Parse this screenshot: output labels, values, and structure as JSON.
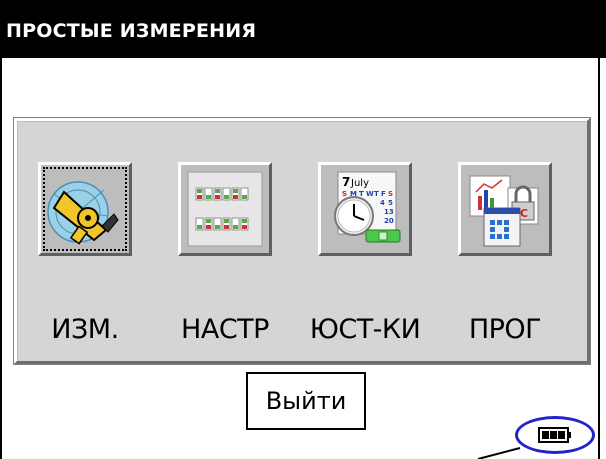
{
  "title": "ПРОСТЫЕ ИЗМЕРЕНИЯ",
  "menu": [
    {
      "label": "ИЗМ.",
      "icon": "measuring-tape-icon"
    },
    {
      "label": "НАСТР",
      "icon": "settings-switches-icon"
    },
    {
      "label": "ЮСТ-КИ",
      "icon": "calendar-clock-icon"
    },
    {
      "label": "ПРОГ",
      "icon": "programs-icon"
    }
  ],
  "calendar_day": "7",
  "calendar_month": "July",
  "exit_label": "Выйти",
  "colors": {
    "titlebar": "#000000",
    "panel": "#d5d5d5",
    "highlight": "#2222cc"
  }
}
